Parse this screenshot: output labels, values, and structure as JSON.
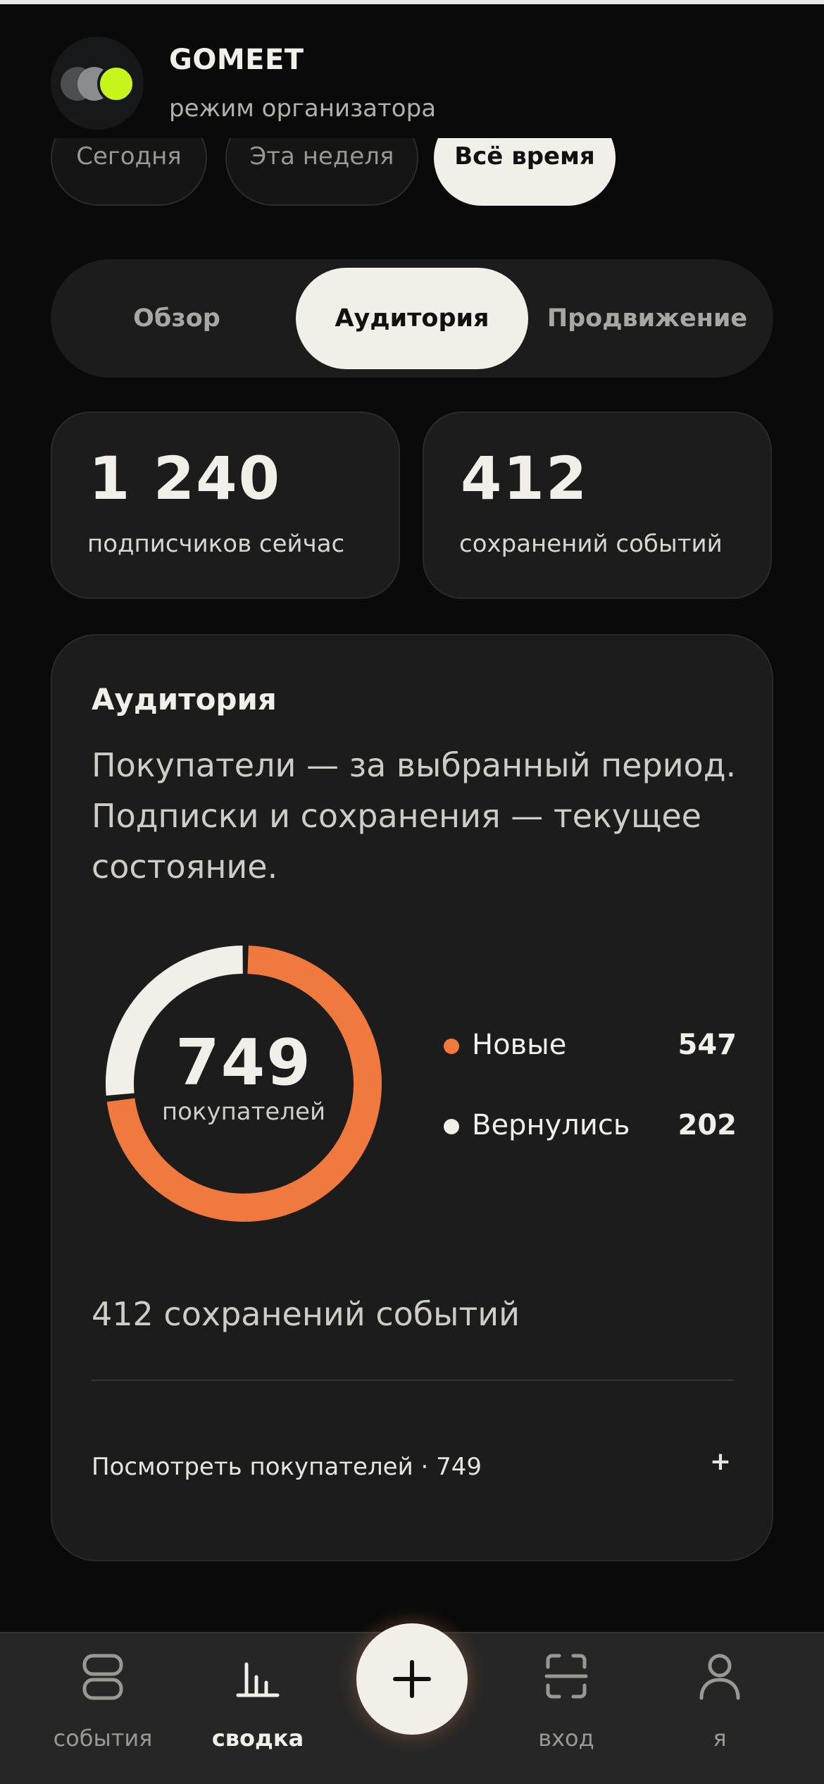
{
  "header": {
    "brand": "GOMEET",
    "mode": "режим организатора"
  },
  "period_chips": [
    {
      "label": "Сегодня",
      "selected": false
    },
    {
      "label": "Эта неделя",
      "selected": false
    },
    {
      "label": "Всё время",
      "selected": true
    }
  ],
  "tabs": [
    {
      "label": "Обзор",
      "selected": false
    },
    {
      "label": "Аудитория",
      "selected": true
    },
    {
      "label": "Продвижение",
      "selected": false
    }
  ],
  "stats": [
    {
      "value": "1 240",
      "label": "подписчиков сейчас"
    },
    {
      "value": "412",
      "label": "сохранений событий"
    }
  ],
  "audience": {
    "title": "Аудитория",
    "description": "Покупатели — за выбранный период. Подписки и сохранения — текущее состояние.",
    "total": "749",
    "total_label": "покупателей",
    "saves": "412 сохранений событий",
    "view_link": "Посмотреть покупателей · 749",
    "view_plus": "+"
  },
  "chart_data": {
    "type": "pie",
    "categories": [
      "Новые",
      "Вернулись"
    ],
    "values": [
      547,
      202
    ],
    "colors": [
      "#f07a3e",
      "#f2efe8"
    ]
  },
  "nav": {
    "events": "события",
    "summary": "сводка",
    "entry": "вход",
    "me": "я"
  },
  "colors": {
    "accent": "#f07a3e",
    "light": "#f2efe8",
    "logo_green": "#c6f51c"
  }
}
